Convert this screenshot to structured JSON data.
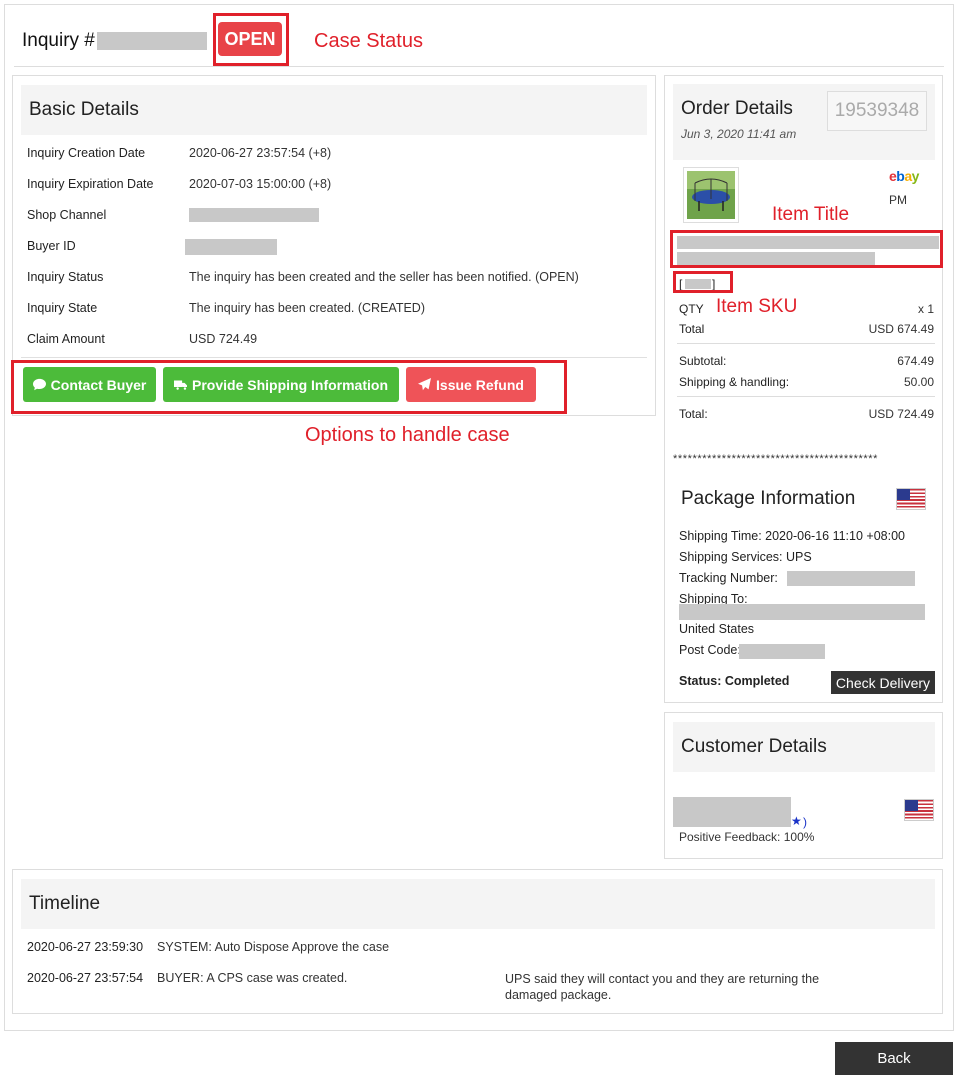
{
  "header": {
    "inquiry_label": "Inquiry #",
    "status": "OPEN"
  },
  "annotations": {
    "case_status": "Case Status",
    "options": "Options to handle case",
    "item_title": "Item Title",
    "item_sku": "Item SKU"
  },
  "basic_details": {
    "title": "Basic Details",
    "rows": [
      {
        "label": "Inquiry Creation Date",
        "value": "2020-06-27 23:57:54 (+8)"
      },
      {
        "label": "Inquiry Expiration Date",
        "value": "2020-07-03 15:00:00 (+8)"
      },
      {
        "label": "Shop Channel",
        "value": ""
      },
      {
        "label": "Buyer ID",
        "value": ""
      },
      {
        "label": "Inquiry Status",
        "value": "The inquiry has been created and the seller has been notified. (OPEN)"
      },
      {
        "label": "Inquiry State",
        "value": "The inquiry has been created. (CREATED)"
      },
      {
        "label": "Claim Amount",
        "value": "USD 724.49"
      }
    ],
    "buttons": {
      "contact_buyer": "Contact Buyer",
      "provide_shipping": "Provide Shipping Information",
      "issue_refund": "Issue Refund"
    }
  },
  "order_details": {
    "title": "Order Details",
    "date": "Jun 3, 2020 11:41 am",
    "order_number": "19539348",
    "channel_logo": [
      "e",
      "b",
      "a",
      "y"
    ],
    "item_time": "PM",
    "sku_bracket_open": "[",
    "sku_bracket_close": "]",
    "qty_label": "QTY",
    "qty_value": "x 1",
    "total_label": "Total",
    "total_value": "USD 674.49",
    "subtotal_label": "Subtotal:",
    "subtotal_value": "674.49",
    "shipping_label": "Shipping & handling:",
    "shipping_value": "50.00",
    "grand_total_label": "Total:",
    "grand_total_value": "USD 724.49",
    "separator": "******************************************"
  },
  "package_info": {
    "title": "Package Information",
    "shipping_time": "Shipping Time: 2020-06-16 11:10 +08:00",
    "shipping_services": "Shipping Services: UPS",
    "tracking_label": "Tracking Number:",
    "shipping_to_label": "Shipping To:",
    "country": "United States",
    "post_code_label": "Post Code:",
    "status": "Status: Completed",
    "check_delivery": "Check Delivery"
  },
  "customer_details": {
    "title": "Customer Details",
    "feedback_suffix": ")",
    "feedback": "Positive Feedback: 100%"
  },
  "timeline": {
    "title": "Timeline",
    "entries": [
      {
        "time": "2020-06-27 23:59:30",
        "message": "SYSTEM: Auto Dispose Approve the case",
        "note": ""
      },
      {
        "time": "2020-06-27 23:57:54",
        "message": "BUYER: A CPS case was created.",
        "note": "UPS said they will contact you and they are returning the damaged package."
      }
    ]
  },
  "back_label": "Back",
  "colors": {
    "accent_red": "#e84348",
    "annotation_red": "#e0202a",
    "button_green": "#4cbb3a",
    "button_red": "#ef5358"
  }
}
